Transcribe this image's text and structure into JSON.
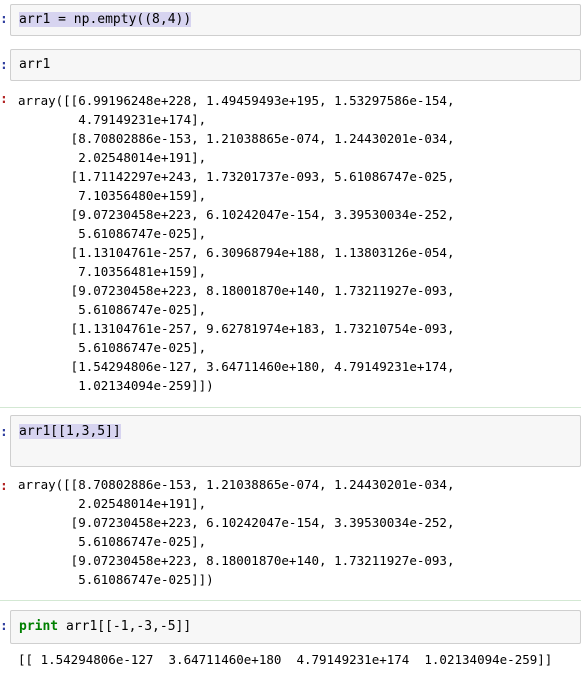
{
  "cells": {
    "c1": {
      "code": "arr1 = np.empty((8,4))"
    },
    "c2": {
      "code": "arr1",
      "output": [
        "array([[6.99196248e+228, 1.49459493e+195, 1.53297586e-154,",
        "        4.79149231e+174],",
        "       [8.70802886e-153, 1.21038865e-074, 1.24430201e-034,",
        "        2.02548014e+191],",
        "       [1.71142297e+243, 1.73201737e-093, 5.61086747e-025,",
        "        7.10356480e+159],",
        "       [9.07230458e+223, 6.10242047e-154, 3.39530034e-252,",
        "        5.61086747e-025],",
        "       [1.13104761e-257, 6.30968794e+188, 1.13803126e-054,",
        "        7.10356481e+159],",
        "       [9.07230458e+223, 8.18001870e+140, 1.73211927e-093,",
        "        5.61086747e-025],",
        "       [1.13104761e-257, 9.62781974e+183, 1.73210754e-093,",
        "        5.61086747e-025],",
        "       [1.54294806e-127, 3.64711460e+180, 4.79149231e+174,",
        "        1.02134094e-259]])"
      ]
    },
    "c3": {
      "code": "arr1[[1,3,5]]",
      "output": [
        "array([[8.70802886e-153, 1.21038865e-074, 1.24430201e-034,",
        "        2.02548014e+191],",
        "       [9.07230458e+223, 6.10242047e-154, 3.39530034e-252,",
        "        5.61086747e-025],",
        "       [9.07230458e+223, 8.18001870e+140, 1.73211927e-093,",
        "        5.61086747e-025]])"
      ]
    },
    "c4": {
      "code_keyword": "print",
      "code_rest": " arr1[[-1,-3,-5]]",
      "output": "[[ 1.54294806e-127  3.64711460e+180  4.79149231e+174  1.02134094e-259]]"
    }
  },
  "prompt_marker": ":"
}
